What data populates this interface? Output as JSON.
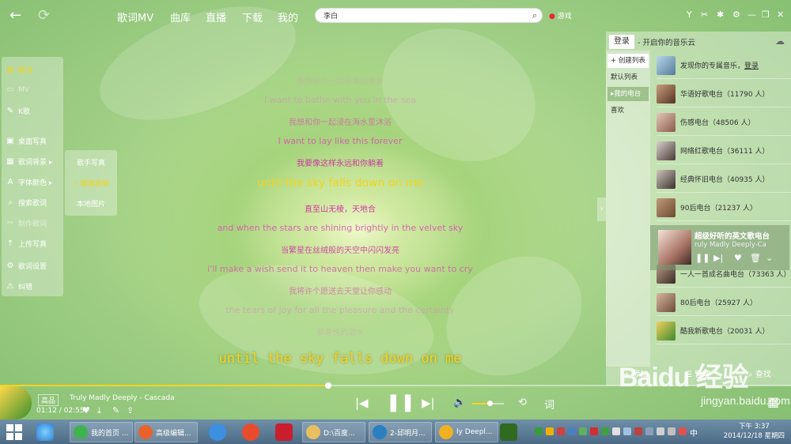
{
  "topbar": {
    "nav": [
      "歌词MV",
      "曲库",
      "直播",
      "下载",
      "我的"
    ],
    "active_nav": "歌词MV",
    "search_value": "李白",
    "game_label": "游戏"
  },
  "left_menu": {
    "items": [
      {
        "label": "歌词",
        "icon": "lyrics-icon",
        "state": "selected"
      },
      {
        "label": "MV",
        "icon": "mv-icon",
        "state": "dim"
      },
      {
        "label": "K歌",
        "icon": "mic-icon",
        "state": "normal"
      },
      {
        "label": "桌面写真",
        "icon": "picture-icon",
        "state": "normal"
      },
      {
        "label": "歌词背景 ▸",
        "icon": "background-icon",
        "state": "normal"
      },
      {
        "label": "字体颜色 ▸",
        "icon": "font-icon",
        "state": "normal"
      },
      {
        "label": "搜索歌词",
        "icon": "search-icon",
        "state": "normal"
      },
      {
        "label": "制作歌词",
        "icon": "make-icon",
        "state": "dim"
      },
      {
        "label": "上传写真",
        "icon": "upload-icon",
        "state": "normal"
      },
      {
        "label": "歌词设置",
        "icon": "gear-icon",
        "state": "normal"
      },
      {
        "label": "纠错",
        "icon": "warning-icon",
        "state": "normal"
      }
    ]
  },
  "submenu": {
    "items": [
      {
        "label": "歌手写真",
        "selected": false
      },
      {
        "label": "✓ 酷我皮肤",
        "selected": true
      },
      {
        "label": "本地图片",
        "selected": false
      }
    ]
  },
  "lyrics": {
    "lines": [
      {
        "text": "我想陪你一起在海边漫步",
        "color": "#d98cc0",
        "opacity": 0.25,
        "size": 10
      },
      {
        "text": "I want to bathe with you in the sea",
        "color": "#d98cc0",
        "opacity": 0.55,
        "size": 11
      },
      {
        "text": "我想和你一起浸在海水里沐浴",
        "color": "#d462a8",
        "opacity": 0.75,
        "size": 10
      },
      {
        "text": "I want to lay like this forever",
        "color": "#d85ab2",
        "opacity": 0.9,
        "size": 11
      },
      {
        "text": "我要像这样永远和你躺着",
        "color": "#cf3aa3",
        "opacity": 1,
        "size": 10
      },
      {
        "text": "until the sky falls down on me",
        "color": "#f5d31e",
        "opacity": 1,
        "size": 14
      },
      {
        "text": "直至山无棱，天地合",
        "color": "#cf3aa3",
        "opacity": 1,
        "size": 10
      },
      {
        "text": "and when the stars are shining brightly in the velvet sky",
        "color": "#d85ab2",
        "opacity": 0.9,
        "size": 11
      },
      {
        "text": "当繁星在丝绒般的天空中闪闪发亮",
        "color": "#cf3aa3",
        "opacity": 0.9,
        "size": 10
      },
      {
        "text": "i'll make a wish send it to heaven then make you want to cry",
        "color": "#d462a8",
        "opacity": 0.85,
        "size": 11
      },
      {
        "text": "我将许个愿送去天堂让你感动",
        "color": "#d462a8",
        "opacity": 0.7,
        "size": 10
      },
      {
        "text": "the tears of joy for all the pleasure and the certainty",
        "color": "#d98cc0",
        "opacity": 0.55,
        "size": 11
      },
      {
        "text": "那喜悦的泪水",
        "color": "#d98cc0",
        "opacity": 0.3,
        "size": 10
      }
    ],
    "desktop_line": "until the sky falls down on me"
  },
  "right_panel": {
    "login_tab": "登录",
    "slogan": "- 开启你的音乐云",
    "tabs": [
      {
        "label": "+ 创建列表",
        "type": "create"
      },
      {
        "label": "默认列表",
        "type": "normal"
      },
      {
        "label": "▸我的电台",
        "type": "selected"
      },
      {
        "label": "喜欢",
        "type": "normal"
      }
    ],
    "promo": {
      "text": "发现你的专属音乐，",
      "link": "登录"
    },
    "stations": [
      {
        "name": "华语好歌电台（11790 人）"
      },
      {
        "name": "伤感电台（48506 人）"
      },
      {
        "name": "网络红歌电台（36111 人）"
      },
      {
        "name": "经典怀旧电台（40935 人）"
      },
      {
        "name": "90后电台（21237 人）"
      },
      {
        "name": "一人一首成名曲电台（73363 人）"
      },
      {
        "name": "80后电台（25927 人）"
      },
      {
        "name": "酷我新歌电台（20031 人）"
      }
    ],
    "featured": {
      "title": "超级好听的英文歌电台",
      "subtitle": "ruly Madly Deeply-Ca",
      "controls": [
        "pause-icon",
        "next-icon",
        "heart-icon",
        "trash-icon",
        "more-icon"
      ]
    },
    "footer": {
      "add": "添加",
      "manage": "管理",
      "find": "查找"
    }
  },
  "player": {
    "quality": "高品",
    "song": "Truly Madly Deeply - Cascada",
    "time": "01:12 / 02:55",
    "progress": 0.415,
    "volume": 0.55,
    "lyric_button": "词"
  },
  "taskbar": {
    "tasks": [
      {
        "label": "我的首页 ...",
        "color": "#3fb34f"
      },
      {
        "label": "高级编辑...",
        "color": "#e8622c"
      },
      {
        "label": "D:\\百度...",
        "color": "#e8c060"
      },
      {
        "label": "2-邱明月...",
        "color": "#2a7fc0"
      },
      {
        "label": "ly Deepl...",
        "color": "#f0b020"
      }
    ],
    "pinned_colors": [
      "#3d8fe0",
      "#e94c2c",
      "#c91f2c",
      "#2f6a1e"
    ],
    "lang": "中",
    "time": "下午 3:37",
    "date": "2014/12/18 星期四"
  },
  "watermark": {
    "brand": "Baidu 经验",
    "url": "jingyan.baidu.com"
  },
  "colors": {
    "accent": "#f5d31e",
    "lyric_pink": "#cf3aa3"
  }
}
